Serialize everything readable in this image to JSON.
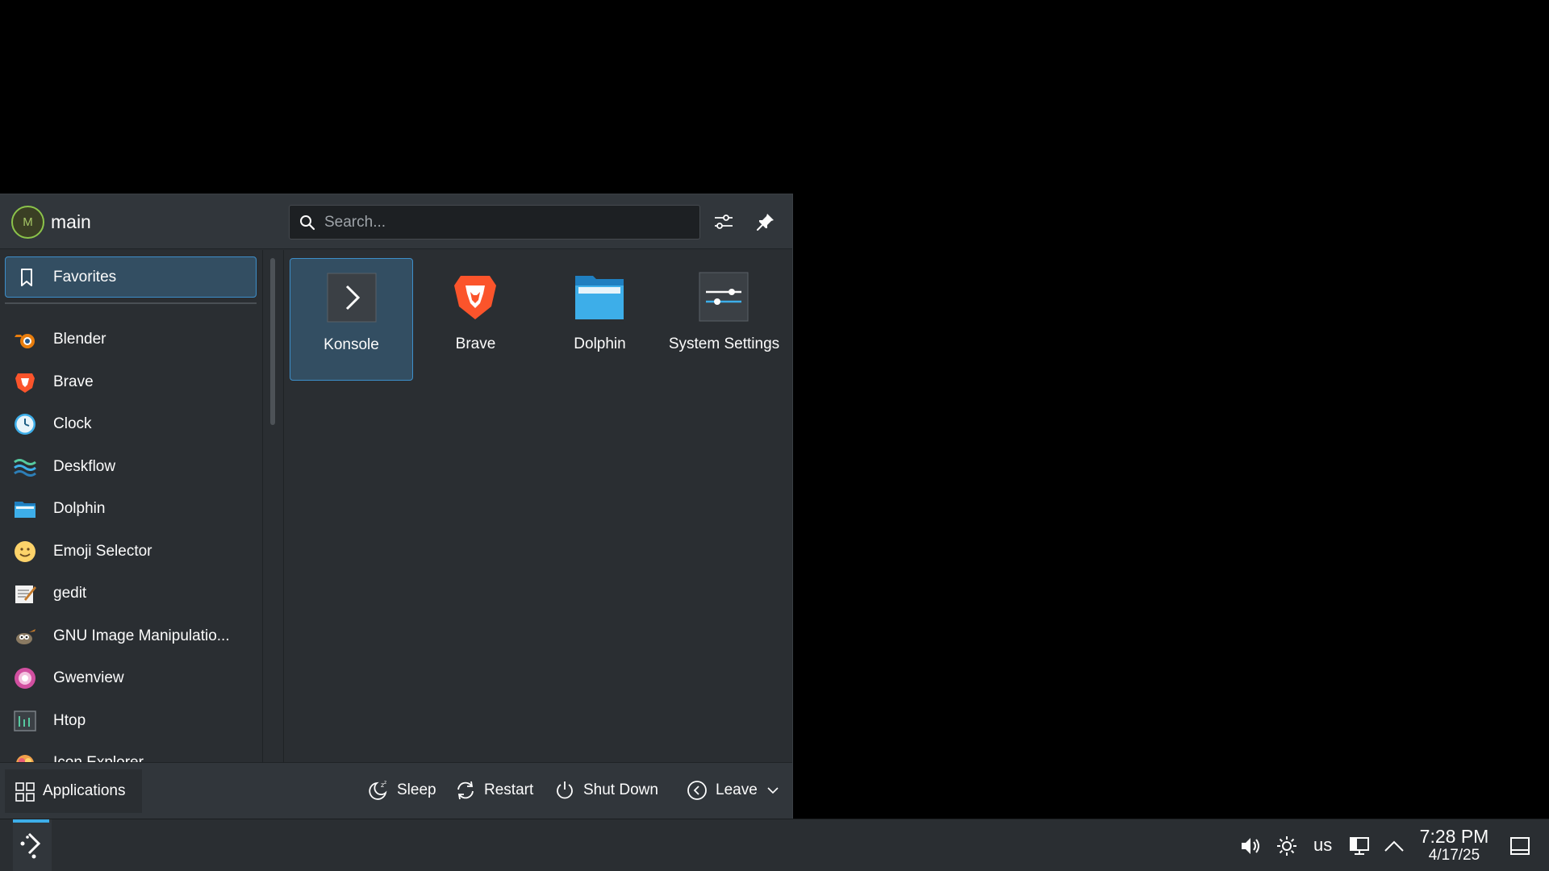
{
  "user": {
    "initial": "M",
    "name": "main"
  },
  "search": {
    "placeholder": "Search..."
  },
  "sidebar": {
    "favorites_label": "Favorites",
    "apps": [
      {
        "label": "Blender",
        "icon": "blender-icon"
      },
      {
        "label": "Brave",
        "icon": "brave-icon"
      },
      {
        "label": "Clock",
        "icon": "clock-icon"
      },
      {
        "label": "Deskflow",
        "icon": "deskflow-icon"
      },
      {
        "label": "Dolphin",
        "icon": "dolphin-icon"
      },
      {
        "label": "Emoji Selector",
        "icon": "emoji-icon"
      },
      {
        "label": "gedit",
        "icon": "gedit-icon"
      },
      {
        "label": "GNU Image Manipulatio...",
        "icon": "gimp-icon"
      },
      {
        "label": "Gwenview",
        "icon": "gwenview-icon"
      },
      {
        "label": "Htop",
        "icon": "htop-icon"
      },
      {
        "label": "Icon Explorer",
        "icon": "icon-explorer-icon"
      }
    ]
  },
  "favorites": [
    {
      "label": "Konsole",
      "icon": "konsole-icon",
      "selected": true
    },
    {
      "label": "Brave",
      "icon": "brave-icon"
    },
    {
      "label": "Dolphin",
      "icon": "dolphin-icon"
    },
    {
      "label": "System Settings",
      "icon": "system-settings-icon"
    }
  ],
  "footer": {
    "applications_label": "Applications",
    "sleep_label": "Sleep",
    "restart_label": "Restart",
    "shutdown_label": "Shut Down",
    "leave_label": "Leave"
  },
  "taskbar": {
    "keyboard_layout": "us",
    "time": "7:28 PM",
    "date": "4/17/25"
  },
  "colors": {
    "accent": "#3daee9",
    "selection": "#334e62",
    "panel": "#2a2e32"
  }
}
